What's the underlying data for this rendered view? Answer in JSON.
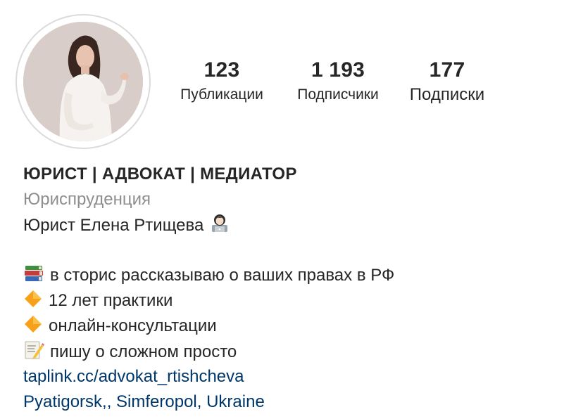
{
  "profile": {
    "avatar_icon": "profile-photo-woman",
    "stats": {
      "posts": {
        "value": "123",
        "label": "Публикации"
      },
      "followers": {
        "value": "1 193",
        "label": "Подписчики"
      },
      "following": {
        "value": "177",
        "label": "Подписки"
      }
    },
    "bio": {
      "name": "ЮРИСТ | АДВОКАТ | МЕДИАТОР",
      "category": "Юриспруденция",
      "line1": {
        "text": "Юрист Елена Ртищева",
        "emoji": "woman-technologist-emoji"
      },
      "line2": {
        "emoji": "books-emoji",
        "text": "в сторис рассказываю о ваших правах в РФ"
      },
      "line3": {
        "emoji": "orange-diamond-emoji",
        "text": "12 лет практики"
      },
      "line4": {
        "emoji": "orange-diamond-emoji",
        "text": "онлайн-консультации"
      },
      "line5": {
        "emoji": "memo-emoji",
        "text": "пишу о сложном просто"
      },
      "website": "taplink.cc/advokat_rtishcheva",
      "location": "Pyatigorsk,, Simferopol, Ukraine"
    },
    "colors": {
      "text": "#262626",
      "secondary": "#8e8e8e",
      "link": "#00376b",
      "ring": "#dbdbdb",
      "diamond": "#f7a11a"
    }
  }
}
